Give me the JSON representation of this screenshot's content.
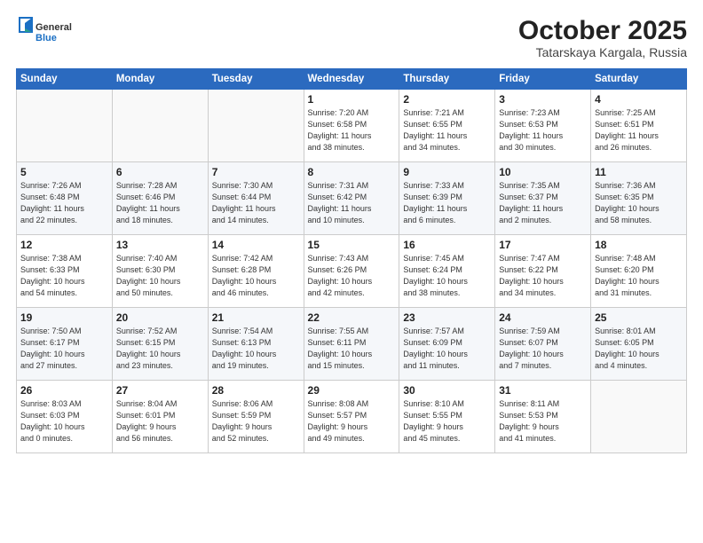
{
  "header": {
    "logo_general": "General",
    "logo_blue": "Blue",
    "month": "October 2025",
    "location": "Tatarskaya Kargala, Russia"
  },
  "weekdays": [
    "Sunday",
    "Monday",
    "Tuesday",
    "Wednesday",
    "Thursday",
    "Friday",
    "Saturday"
  ],
  "weeks": [
    [
      {
        "day": "",
        "info": ""
      },
      {
        "day": "",
        "info": ""
      },
      {
        "day": "",
        "info": ""
      },
      {
        "day": "1",
        "info": "Sunrise: 7:20 AM\nSunset: 6:58 PM\nDaylight: 11 hours\nand 38 minutes."
      },
      {
        "day": "2",
        "info": "Sunrise: 7:21 AM\nSunset: 6:55 PM\nDaylight: 11 hours\nand 34 minutes."
      },
      {
        "day": "3",
        "info": "Sunrise: 7:23 AM\nSunset: 6:53 PM\nDaylight: 11 hours\nand 30 minutes."
      },
      {
        "day": "4",
        "info": "Sunrise: 7:25 AM\nSunset: 6:51 PM\nDaylight: 11 hours\nand 26 minutes."
      }
    ],
    [
      {
        "day": "5",
        "info": "Sunrise: 7:26 AM\nSunset: 6:48 PM\nDaylight: 11 hours\nand 22 minutes."
      },
      {
        "day": "6",
        "info": "Sunrise: 7:28 AM\nSunset: 6:46 PM\nDaylight: 11 hours\nand 18 minutes."
      },
      {
        "day": "7",
        "info": "Sunrise: 7:30 AM\nSunset: 6:44 PM\nDaylight: 11 hours\nand 14 minutes."
      },
      {
        "day": "8",
        "info": "Sunrise: 7:31 AM\nSunset: 6:42 PM\nDaylight: 11 hours\nand 10 minutes."
      },
      {
        "day": "9",
        "info": "Sunrise: 7:33 AM\nSunset: 6:39 PM\nDaylight: 11 hours\nand 6 minutes."
      },
      {
        "day": "10",
        "info": "Sunrise: 7:35 AM\nSunset: 6:37 PM\nDaylight: 11 hours\nand 2 minutes."
      },
      {
        "day": "11",
        "info": "Sunrise: 7:36 AM\nSunset: 6:35 PM\nDaylight: 10 hours\nand 58 minutes."
      }
    ],
    [
      {
        "day": "12",
        "info": "Sunrise: 7:38 AM\nSunset: 6:33 PM\nDaylight: 10 hours\nand 54 minutes."
      },
      {
        "day": "13",
        "info": "Sunrise: 7:40 AM\nSunset: 6:30 PM\nDaylight: 10 hours\nand 50 minutes."
      },
      {
        "day": "14",
        "info": "Sunrise: 7:42 AM\nSunset: 6:28 PM\nDaylight: 10 hours\nand 46 minutes."
      },
      {
        "day": "15",
        "info": "Sunrise: 7:43 AM\nSunset: 6:26 PM\nDaylight: 10 hours\nand 42 minutes."
      },
      {
        "day": "16",
        "info": "Sunrise: 7:45 AM\nSunset: 6:24 PM\nDaylight: 10 hours\nand 38 minutes."
      },
      {
        "day": "17",
        "info": "Sunrise: 7:47 AM\nSunset: 6:22 PM\nDaylight: 10 hours\nand 34 minutes."
      },
      {
        "day": "18",
        "info": "Sunrise: 7:48 AM\nSunset: 6:20 PM\nDaylight: 10 hours\nand 31 minutes."
      }
    ],
    [
      {
        "day": "19",
        "info": "Sunrise: 7:50 AM\nSunset: 6:17 PM\nDaylight: 10 hours\nand 27 minutes."
      },
      {
        "day": "20",
        "info": "Sunrise: 7:52 AM\nSunset: 6:15 PM\nDaylight: 10 hours\nand 23 minutes."
      },
      {
        "day": "21",
        "info": "Sunrise: 7:54 AM\nSunset: 6:13 PM\nDaylight: 10 hours\nand 19 minutes."
      },
      {
        "day": "22",
        "info": "Sunrise: 7:55 AM\nSunset: 6:11 PM\nDaylight: 10 hours\nand 15 minutes."
      },
      {
        "day": "23",
        "info": "Sunrise: 7:57 AM\nSunset: 6:09 PM\nDaylight: 10 hours\nand 11 minutes."
      },
      {
        "day": "24",
        "info": "Sunrise: 7:59 AM\nSunset: 6:07 PM\nDaylight: 10 hours\nand 7 minutes."
      },
      {
        "day": "25",
        "info": "Sunrise: 8:01 AM\nSunset: 6:05 PM\nDaylight: 10 hours\nand 4 minutes."
      }
    ],
    [
      {
        "day": "26",
        "info": "Sunrise: 8:03 AM\nSunset: 6:03 PM\nDaylight: 10 hours\nand 0 minutes."
      },
      {
        "day": "27",
        "info": "Sunrise: 8:04 AM\nSunset: 6:01 PM\nDaylight: 9 hours\nand 56 minutes."
      },
      {
        "day": "28",
        "info": "Sunrise: 8:06 AM\nSunset: 5:59 PM\nDaylight: 9 hours\nand 52 minutes."
      },
      {
        "day": "29",
        "info": "Sunrise: 8:08 AM\nSunset: 5:57 PM\nDaylight: 9 hours\nand 49 minutes."
      },
      {
        "day": "30",
        "info": "Sunrise: 8:10 AM\nSunset: 5:55 PM\nDaylight: 9 hours\nand 45 minutes."
      },
      {
        "day": "31",
        "info": "Sunrise: 8:11 AM\nSunset: 5:53 PM\nDaylight: 9 hours\nand 41 minutes."
      },
      {
        "day": "",
        "info": ""
      }
    ]
  ]
}
